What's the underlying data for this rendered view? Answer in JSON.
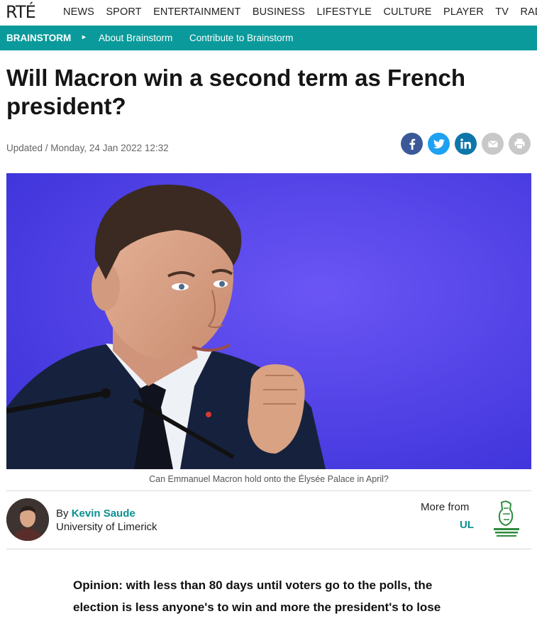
{
  "brand": {
    "logo_text": "RTÉ"
  },
  "nav": {
    "items": [
      "NEWS",
      "SPORT",
      "ENTERTAINMENT",
      "BUSINESS",
      "LIFESTYLE",
      "CULTURE",
      "PLAYER",
      "TV",
      "RADIO"
    ]
  },
  "section": {
    "title": "BRAINSTORM",
    "arrow": "►",
    "links": [
      "About Brainstorm",
      "Contribute to Brainstorm"
    ]
  },
  "article": {
    "headline": "Will Macron win a second term as French president?",
    "updated": "Updated / Monday, 24 Jan 2022 12:32",
    "caption": "Can Emmanuel Macron hold onto the Élysée Palace in April?",
    "author": {
      "by_prefix": "By",
      "name": "Kevin Saude",
      "affiliation": "University of Limerick"
    },
    "more_from": {
      "label": "More from",
      "org": "UL"
    },
    "intro": "Opinion: with less than 80 days until voters go to the polls, the election is less anyone's to win and more the president's to lose"
  },
  "share": [
    {
      "name": "facebook",
      "icon": "facebook-icon",
      "color": "#3b5998"
    },
    {
      "name": "twitter",
      "icon": "twitter-icon",
      "color": "#1da1f2"
    },
    {
      "name": "linkedin",
      "icon": "linkedin-icon",
      "color": "#0e76a8"
    },
    {
      "name": "email",
      "icon": "email-icon",
      "color": "#c8c8c8"
    },
    {
      "name": "print",
      "icon": "print-icon",
      "color": "#c8c8c8"
    }
  ],
  "colors": {
    "accent": "#0b9a9b",
    "link": "#0a8f90",
    "hero_bg": "#5546f0"
  }
}
